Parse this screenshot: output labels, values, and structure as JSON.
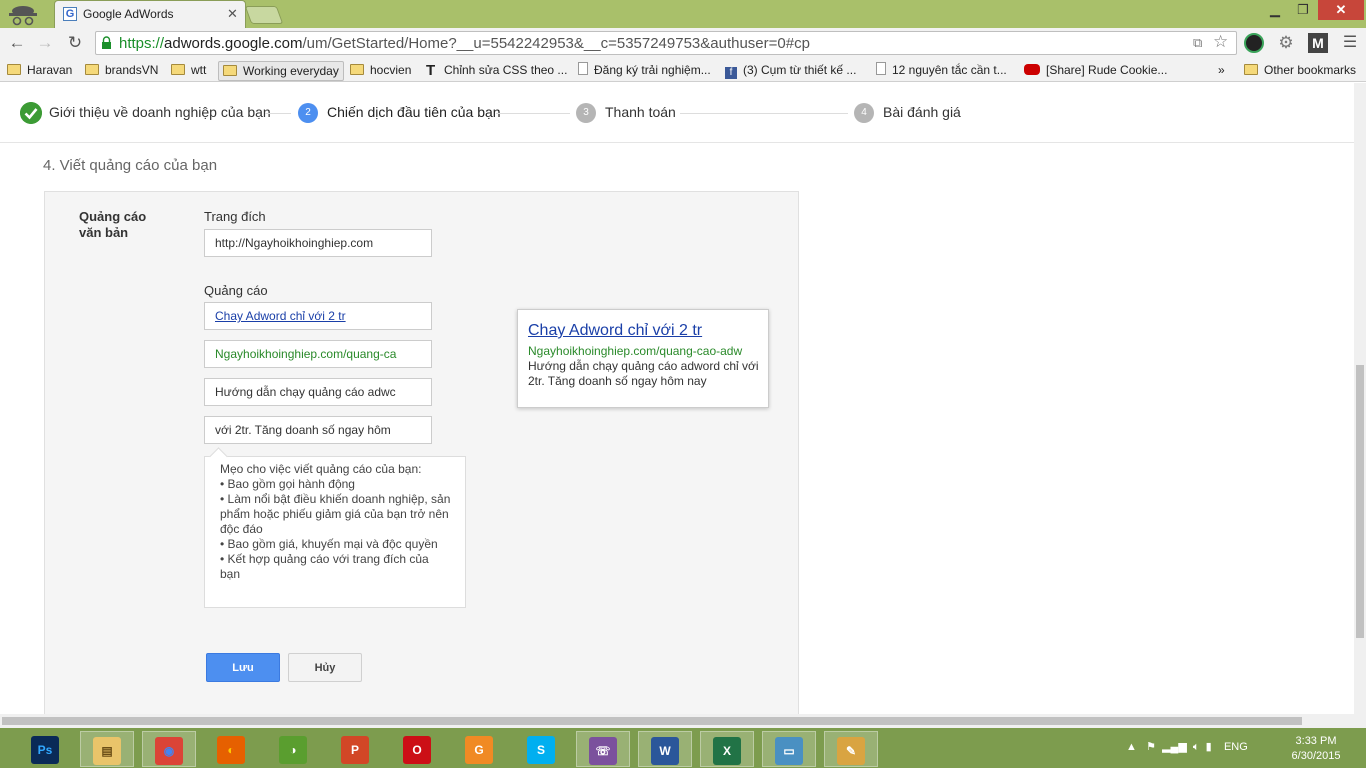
{
  "browser": {
    "tab_title": "Google AdWords",
    "tab_favicon": "G",
    "url_https": "https://",
    "url_host": "adwords.google.com",
    "url_path": "/um/GetStarted/Home?__u=5542242953&__c=5357249753&authuser=0#cp",
    "window_controls": {
      "minimize": "▁",
      "maximize": "❐",
      "close": "✕"
    },
    "nav_icons": {
      "back": "←",
      "forward": "→",
      "reload": "↻",
      "menu": "☰",
      "star": "☆"
    },
    "extension_m": "M",
    "bookmarks": [
      {
        "label": "Haravan",
        "icon": "folder-icon"
      },
      {
        "label": "brandsVN",
        "icon": "folder-icon"
      },
      {
        "label": "wtt",
        "icon": "folder-icon"
      },
      {
        "label": "Working everyday",
        "icon": "folder-icon"
      },
      {
        "label": "hocvien",
        "icon": "folder-icon"
      },
      {
        "label": "Chỉnh sửa CSS theo ...",
        "icon": "text-icon"
      },
      {
        "label": "Đăng ký trải nghiệm...",
        "icon": "page-icon"
      },
      {
        "label": "(3) Cụm từ thiết kế ...",
        "icon": "facebook-icon"
      },
      {
        "label": "12 nguyên tắc cần t...",
        "icon": "page-icon"
      },
      {
        "label": "[Share] Rude Cookie...",
        "icon": "youtube-icon"
      }
    ],
    "bookmarks_overflow": "»",
    "other_bookmarks": "Other bookmarks"
  },
  "stepper": {
    "steps": [
      {
        "num": "",
        "label": "Giới thiệu về doanh nghiệp của bạn",
        "state": "done"
      },
      {
        "num": "2",
        "label": "Chiến dịch đầu tiên của bạn",
        "state": "active"
      },
      {
        "num": "3",
        "label": "Thanh toán",
        "state": "pending"
      },
      {
        "num": "4",
        "label": "Bài đánh giá",
        "state": "pending"
      }
    ]
  },
  "section_title": "4. Viết quảng cáo của bạn",
  "form": {
    "panel_label": "Quảng cáo văn bản",
    "landing_label": "Trang đích",
    "landing_value": "http://Ngayhoikhoinghiep.com",
    "ad_label": "Quảng cáo",
    "headline_value": "Chay Adword chỉ với 2 tr",
    "display_url_value": "Ngayhoikhoinghiep.com/quang-ca",
    "desc1_value": "Hướng dẫn chạy quảng cáo adwc",
    "desc2_value": "với 2tr. Tăng doanh số ngay hôm",
    "tips": {
      "title": "Mẹo cho việc viết quảng cáo của bạn:",
      "items": [
        "• Bao gồm gọi hành động",
        "• Làm nổi bật điều khiến doanh nghiệp, sản phẩm hoặc phiếu giảm giá của bạn trở nên độc đáo",
        "• Bao gồm giá, khuyến mại và độc quyền",
        "• Kết hợp quảng cáo với trang đích của bạn"
      ]
    },
    "save_label": "Lưu",
    "cancel_label": "Hủy"
  },
  "preview": {
    "headline": "Chay Adword chỉ với 2 tr",
    "display_url": "Ngayhoikhoinghiep.com/quang-cao-adw",
    "description": "Hướng dẫn chạy quảng cáo adword chỉ với 2tr. Tăng doanh số ngay hôm nay"
  },
  "taskbar": {
    "apps": [
      {
        "name": "photoshop",
        "glyph": "Ps",
        "color": "#0a2a57",
        "fg": "#31a8ff"
      },
      {
        "name": "file-explorer",
        "glyph": "▤",
        "color": "#e9c46a",
        "fg": "#6b4e16"
      },
      {
        "name": "chrome",
        "glyph": "◉",
        "color": "#db4437",
        "fg": "#4285f4"
      },
      {
        "name": "firefox",
        "glyph": "◐",
        "color": "#e66000",
        "fg": "#ffcb00"
      },
      {
        "name": "coccoc",
        "glyph": "◑",
        "color": "#5a9e2f",
        "fg": "#fff"
      },
      {
        "name": "powerpoint",
        "glyph": "P",
        "color": "#d24726",
        "fg": "#fff"
      },
      {
        "name": "opera",
        "glyph": "O",
        "color": "#cc0f16",
        "fg": "#fff"
      },
      {
        "name": "foxit-pdf",
        "glyph": "G",
        "color": "#f08a24",
        "fg": "#fff"
      },
      {
        "name": "skype",
        "glyph": "S",
        "color": "#00aff0",
        "fg": "#fff"
      },
      {
        "name": "viber",
        "glyph": "☏",
        "color": "#7b519d",
        "fg": "#fff"
      },
      {
        "name": "word",
        "glyph": "W",
        "color": "#2b579a",
        "fg": "#fff"
      },
      {
        "name": "excel",
        "glyph": "X",
        "color": "#217346",
        "fg": "#fff"
      },
      {
        "name": "photo-viewer",
        "glyph": "▭",
        "color": "#4a90c2",
        "fg": "#fff"
      },
      {
        "name": "paint",
        "glyph": "✎",
        "color": "#d9a441",
        "fg": "#fff"
      }
    ],
    "lang": "ENG",
    "time": "3:33 PM",
    "date": "6/30/2015"
  }
}
